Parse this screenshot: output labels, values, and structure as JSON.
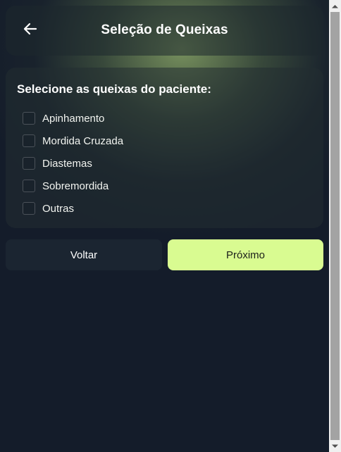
{
  "header": {
    "title": "Seleção de Queixas",
    "back_icon": "arrow-left-icon"
  },
  "complaints": {
    "title": "Selecione as queixas do paciente:",
    "options": [
      {
        "label": "Apinhamento",
        "checked": false
      },
      {
        "label": "Mordida Cruzada",
        "checked": false
      },
      {
        "label": "Diastemas",
        "checked": false
      },
      {
        "label": "Sobremordida",
        "checked": false
      },
      {
        "label": "Outras",
        "checked": false
      }
    ]
  },
  "actions": {
    "back_label": "Voltar",
    "next_label": "Próximo"
  },
  "colors": {
    "accent": "#d9fb91",
    "background": "#141c2a"
  }
}
